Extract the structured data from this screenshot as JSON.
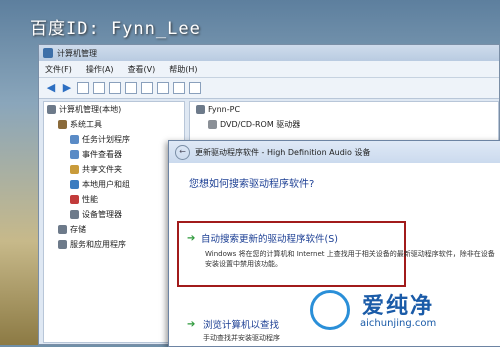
{
  "watermark": "百度ID: Fynn_Lee",
  "window": {
    "title": "计算机管理",
    "menu": [
      "文件(F)",
      "操作(A)",
      "查看(V)",
      "帮助(H)"
    ],
    "tree": {
      "root": "计算机管理(本地)",
      "items": [
        {
          "label": "系统工具",
          "indent": 1,
          "color": "#8a6a3a"
        },
        {
          "label": "任务计划程序",
          "indent": 2,
          "color": "#5a8bc6"
        },
        {
          "label": "事件查看器",
          "indent": 2,
          "color": "#5a8bc6"
        },
        {
          "label": "共享文件夹",
          "indent": 2,
          "color": "#c99b3a"
        },
        {
          "label": "本地用户和组",
          "indent": 2,
          "color": "#3b7cc0"
        },
        {
          "label": "性能",
          "indent": 2,
          "color": "#c23b3b"
        },
        {
          "label": "设备管理器",
          "indent": 2,
          "color": "#6d7a8a"
        },
        {
          "label": "存储",
          "indent": 1,
          "color": "#6d7a8a"
        },
        {
          "label": "服务和应用程序",
          "indent": 1,
          "color": "#6d7a8a"
        }
      ]
    },
    "devices": {
      "computer": "Fynn-PC",
      "items": [
        "DVD/CD-ROM 驱动器"
      ]
    }
  },
  "dialog": {
    "title": "更新驱动程序软件 - High Definition Audio 设备",
    "question": "您想如何搜索驱动程序软件?",
    "option1": {
      "title": "自动搜索更新的驱动程序软件(S)",
      "desc": "Windows 将在您的计算机和 Internet 上查找用于相关设备的最新驱动程序软件，除非在设备安装设置中禁用该功能。"
    },
    "option2": {
      "title": "浏览计算机以查找",
      "desc": "手动查找并安装驱动程序"
    }
  },
  "logo": {
    "text": "爱纯净",
    "url": "aichunjing.com"
  }
}
